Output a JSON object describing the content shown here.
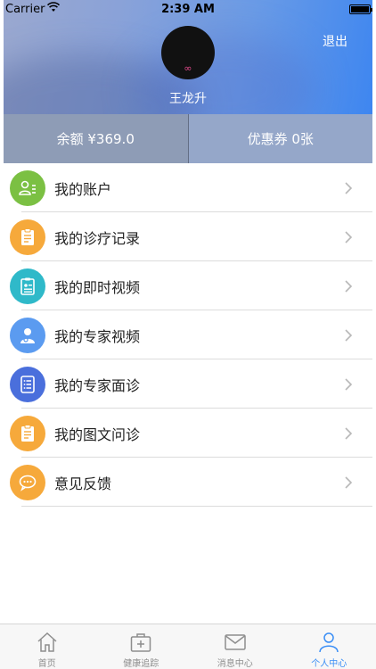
{
  "status_bar": {
    "carrier": "Carrier",
    "time": "2:39 AM"
  },
  "profile": {
    "name": "王龙升",
    "avatar_glyph": "∞",
    "logout_label": "退出"
  },
  "stats": {
    "balance": "余额 ¥369.0",
    "coupons": "优惠券 0张"
  },
  "menu": [
    {
      "label": "我的账户",
      "icon": "account-icon",
      "color": "#7bc043"
    },
    {
      "label": "我的诊疗记录",
      "icon": "clipboard-icon",
      "color": "#f6a93b"
    },
    {
      "label": "我的即时视频",
      "icon": "video-doc-icon",
      "color": "#2fb9c9"
    },
    {
      "label": "我的专家视频",
      "icon": "doctor-icon",
      "color": "#5b9bf0"
    },
    {
      "label": "我的专家面诊",
      "icon": "list-icon",
      "color": "#4a6fdc"
    },
    {
      "label": "我的图文问诊",
      "icon": "clipboard-icon",
      "color": "#f6a93b"
    },
    {
      "label": "意见反馈",
      "icon": "chat-bubble-icon",
      "color": "#f6a93b"
    }
  ],
  "tabbar": [
    {
      "label": "首页",
      "icon": "home-icon",
      "active": false
    },
    {
      "label": "健康追踪",
      "icon": "medical-kit-icon",
      "active": false
    },
    {
      "label": "消息中心",
      "icon": "mail-icon",
      "active": false
    },
    {
      "label": "个人中心",
      "icon": "person-icon",
      "active": true
    }
  ],
  "colors": {
    "accent": "#3a8ef6",
    "inactive": "#8e8e8e"
  }
}
